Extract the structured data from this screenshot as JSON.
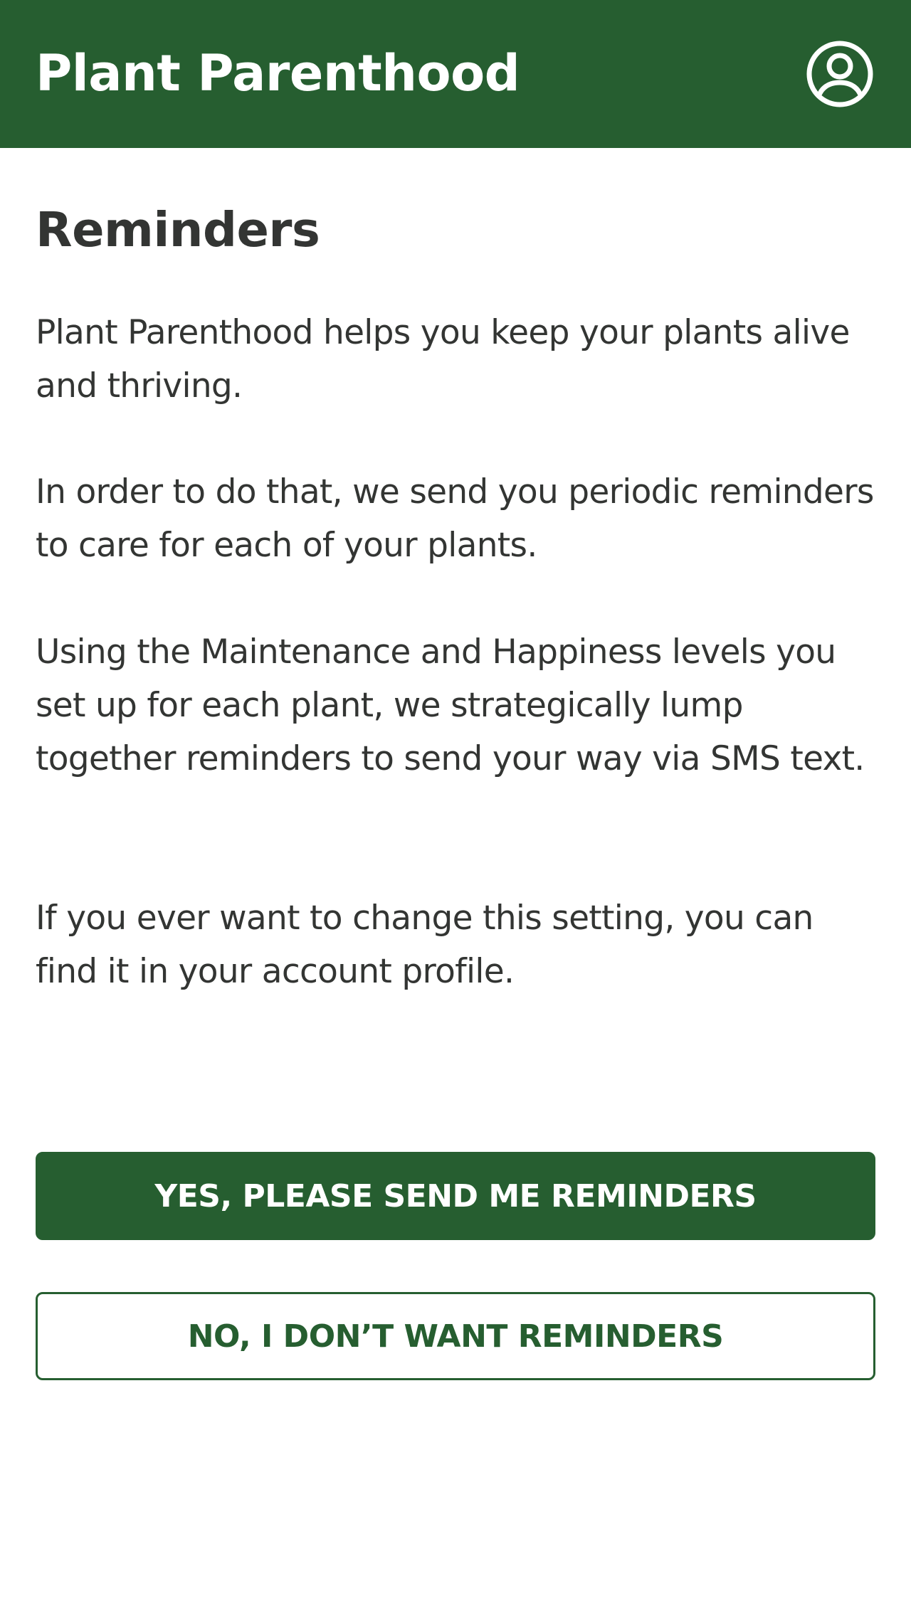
{
  "header": {
    "title": "Plant Parenthood",
    "background_color": "#265e30",
    "profile_icon": "user-circle-icon"
  },
  "main": {
    "title": "Reminders",
    "paragraphs": [
      "Plant Parenthood helps you keep your plants alive and thriving.",
      "In order to do that, we send you periodic reminders to care for each of your plants.",
      "Using the Maintenance and Happiness levels you set up for each plant, we strategically lump together reminders to send your way via SMS text.",
      "If you ever want to change this setting, you can find it in your account profile."
    ]
  },
  "actions": {
    "yes_label": "YES, PLEASE SEND ME REMINDERS",
    "no_label": "NO, I DON’T WANT REMINDERS"
  },
  "colors": {
    "brand_green": "#265e30",
    "text": "#333533",
    "background": "#ffffff"
  }
}
